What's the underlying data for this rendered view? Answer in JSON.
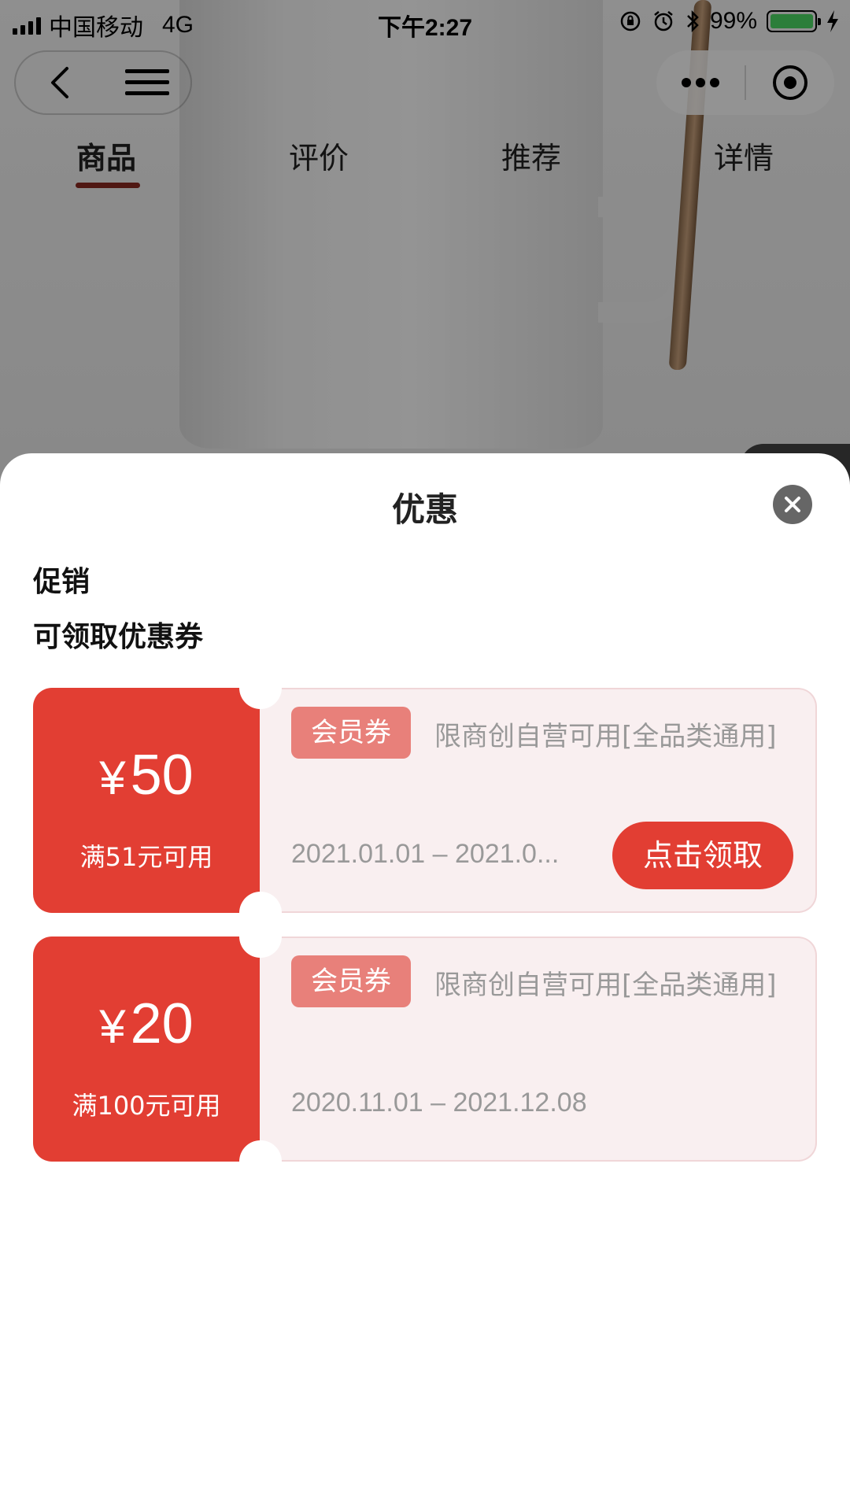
{
  "status_bar": {
    "carrier": "中国移动",
    "network": "4G",
    "time": "下午2:27",
    "battery": "99%"
  },
  "tabs": [
    "商品",
    "评价",
    "推荐",
    "详情"
  ],
  "sheet": {
    "title": "优惠",
    "promotion_label": "促销",
    "coupons_label": "可领取优惠券"
  },
  "coupons": [
    {
      "currency": "¥",
      "amount": "50",
      "condition": "满51元可用",
      "badge": "会员券",
      "description": "限商创自营可用[全品类通用]",
      "dates": "2021.01.01 – 2021.0...",
      "button": "点击领取"
    },
    {
      "currency": "¥",
      "amount": "20",
      "condition": "满100元可用",
      "badge": "会员券",
      "description": "限商创自营可用[全品类通用]",
      "dates": "2020.11.01 – 2021.12.08"
    }
  ],
  "colors": {
    "accent": "#e23e33",
    "badge": "#e8807a",
    "coupon_bg": "#f9eff0"
  }
}
